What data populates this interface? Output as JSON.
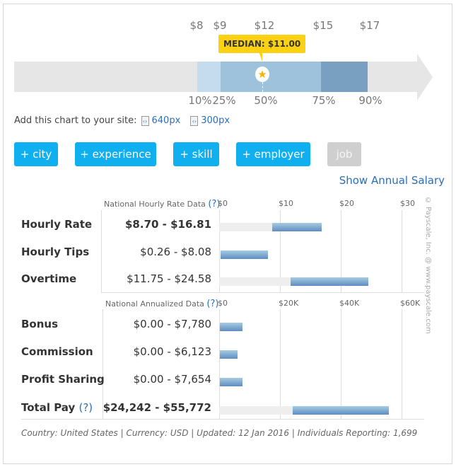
{
  "percentile_chart": {
    "values": [
      "$8",
      "$9",
      "$12",
      "$15",
      "$17"
    ],
    "percentiles": [
      "10%",
      "25%",
      "50%",
      "75%",
      "90%"
    ],
    "median_label": "MEDIAN: $11.00",
    "colors": {
      "p10_25": "#c4dcee",
      "p25_75": "#9fc2dc",
      "p75_90": "#7aa0c1",
      "track": "#e6e6e6",
      "median": "#fbd213"
    }
  },
  "embed": {
    "label": "Add this chart to your site:",
    "link1": "640px",
    "link2": "300px"
  },
  "filters": [
    "+ city",
    "+ experience",
    "+ skill",
    "+ employer",
    "job"
  ],
  "show_annual": "Show Annual Salary",
  "hourly": {
    "header": "National Hourly Rate Data",
    "help": "(?)",
    "ticks": [
      "$0",
      "$10",
      "$20",
      "$30"
    ],
    "axis_max": 30,
    "rows": [
      {
        "label": "Hourly Rate",
        "range": "$8.70 - $16.81",
        "low": 8.7,
        "high": 16.81,
        "bold": true
      },
      {
        "label": "Hourly Tips",
        "range": "$0.26 - $8.08",
        "low": 0.26,
        "high": 8.08
      },
      {
        "label": "Overtime",
        "range": "$11.75 - $24.58",
        "low": 11.75,
        "high": 24.58
      }
    ]
  },
  "annual": {
    "header": "National Annualized Data",
    "help": "(?)",
    "ticks": [
      "$0",
      "$20K",
      "$40K",
      "$60K"
    ],
    "axis_max": 60000,
    "rows": [
      {
        "label": "Bonus",
        "range": "$0.00 - $7,780",
        "low": 0,
        "high": 7780
      },
      {
        "label": "Commission",
        "range": "$0.00 - $6,123",
        "low": 0,
        "high": 6123
      },
      {
        "label": "Profit Sharing",
        "range": "$0.00 - $7,654",
        "low": 0,
        "high": 7654
      },
      {
        "label": "Total Pay",
        "help": "(?)",
        "range": "$24,242 - $55,772",
        "low": 24242,
        "high": 55772,
        "bold": true
      }
    ]
  },
  "copyright": "© Payscale, Inc. @ www.payscale.com",
  "footer": "Country: United States | Currency: USD | Updated: 12 Jan 2016 | Individuals Reporting: 1,699"
}
